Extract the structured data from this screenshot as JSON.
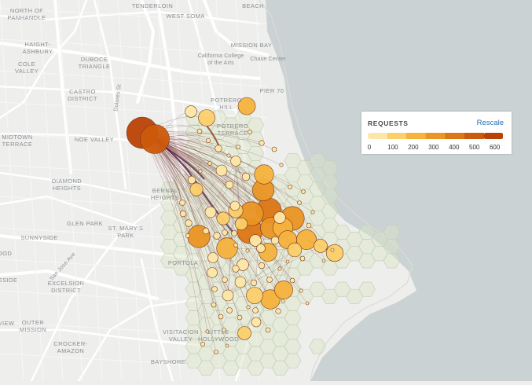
{
  "map": {
    "neighborhoods": [
      {
        "name": "NORTH OF\nPANHANDLE",
        "cls": ""
      },
      {
        "name": "HAIGHT-\nASHBURY",
        "cls": ""
      },
      {
        "name": "COLE\nVALLEY",
        "cls": ""
      },
      {
        "name": "DUBOCE\nTRIANGLE",
        "cls": ""
      },
      {
        "name": "CASTRO\nDISTRICT",
        "cls": ""
      },
      {
        "name": "MIDTOWN\nTERRACE",
        "cls": ""
      },
      {
        "name": "NOE VALLEY",
        "cls": ""
      },
      {
        "name": "DIAMOND\nHEIGHTS",
        "cls": ""
      },
      {
        "name": "GLEN PARK",
        "cls": ""
      },
      {
        "name": "SUNNYSIDE",
        "cls": ""
      },
      {
        "name": "ST. MARY'S\nPARK",
        "cls": ""
      },
      {
        "name": "EXCELSIOR\nDISTRICT",
        "cls": ""
      },
      {
        "name": "OUTER\nMISSION",
        "cls": ""
      },
      {
        "name": "CROCKER-\nAMAZON",
        "cls": ""
      },
      {
        "name": "BERNAL\nHEIGHTS",
        "cls": ""
      },
      {
        "name": "PORTOLA",
        "cls": ""
      },
      {
        "name": "VISITACION\nVALLEY",
        "cls": ""
      },
      {
        "name": "LITTLE\nHOLLYWOOD",
        "cls": ""
      },
      {
        "name": "BAYSHORE",
        "cls": ""
      },
      {
        "name": "POTRERO\nHILL",
        "cls": ""
      },
      {
        "name": "POTRERO\nTERRACE",
        "cls": ""
      },
      {
        "name": "MISSION BAY",
        "cls": ""
      },
      {
        "name": "PIER 70",
        "cls": ""
      },
      {
        "name": "WEST SOMA",
        "cls": ""
      },
      {
        "name": "TENDERLOIN",
        "cls": ""
      },
      {
        "name": "BEACH",
        "cls": ""
      },
      {
        "name": "California College\nof the Arts",
        "cls": "small"
      },
      {
        "name": "Chase Center",
        "cls": "small"
      },
      {
        "name": "OOD",
        "cls": ""
      },
      {
        "name": "ESIDE",
        "cls": ""
      },
      {
        "name": "VIEW",
        "cls": ""
      },
      {
        "name": "Dolores St",
        "cls": "small"
      },
      {
        "name": "San Jose Ave",
        "cls": "small"
      }
    ]
  },
  "legend": {
    "title": "REQUESTS",
    "rescale_label": "Rescale",
    "ticks": [
      "0",
      "100",
      "200",
      "300",
      "400",
      "500",
      "600"
    ],
    "colors": [
      "#fde7a8",
      "#fbcf6a",
      "#f5b23c",
      "#ea9524",
      "#dc7716",
      "#cc5a0c",
      "#b94106"
    ]
  },
  "colors": {
    "water": "#cad2d3",
    "land": "#eeeeec",
    "road": "#ffffff",
    "hex_fill": "#d9e4c8",
    "node_stroke": "#7a3a1c",
    "flow": "#6b1f1f"
  }
}
